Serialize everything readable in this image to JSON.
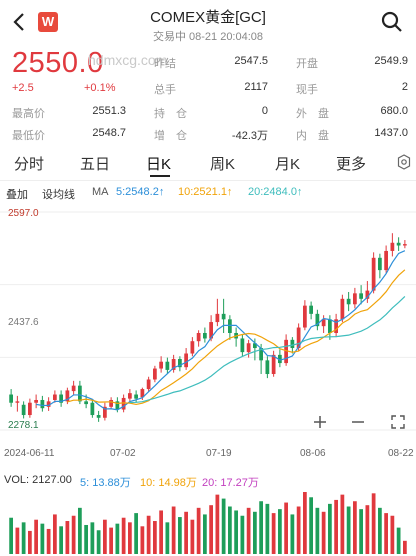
{
  "header": {
    "title": "COMEX黄金[GC]",
    "subtitle": "交易中 08-21 20:04:08",
    "logo_letter": "W",
    "back_icon": "back-arrow-icon",
    "search_icon": "search-icon"
  },
  "quote": {
    "price": "2550.0",
    "change": "+2.5",
    "change_pct": "+0.1%",
    "watermark": "hdmxcg.com",
    "stats": {
      "r1": [
        {
          "label": "昨结",
          "value": "2547.5"
        },
        {
          "label": "开盘",
          "value": "2549.9"
        }
      ],
      "r2": [
        {
          "label": "总手",
          "value": "2117"
        },
        {
          "label": "现手",
          "value": "2"
        }
      ],
      "r3": [
        {
          "label": "最高价",
          "value": "2551.3"
        },
        {
          "label": "持　仓",
          "value": "0"
        },
        {
          "label": "外　盘",
          "value": "680.0"
        }
      ],
      "r4": [
        {
          "label": "最低价",
          "value": "2548.7"
        },
        {
          "label": "增　仓",
          "value": "-42.3万"
        },
        {
          "label": "内　盘",
          "value": "1437.0"
        }
      ]
    }
  },
  "tabs": [
    "分时",
    "五日",
    "日K",
    "周K",
    "月K",
    "更多"
  ],
  "active_tab": "日K",
  "settings_icon": "gear-icon",
  "ma_bar": {
    "overlay": "叠加",
    "set_line": "设均线",
    "ma_label": "MA",
    "ma5": "5:2548.2↑",
    "ma10": "10:2521.1↑",
    "ma20": "20:2484.0↑",
    "colors": {
      "ma5": "#2d8fd9",
      "ma10": "#f0a30a",
      "ma20": "#3fbdbd"
    }
  },
  "chart_data": {
    "type": "candlestick",
    "y_max_label": "2597.0",
    "y_mid_label": "2437.6",
    "y_min_label": "2278.1",
    "ylim": [
      2278.1,
      2597.0
    ],
    "x_labels": [
      "2024-06-11",
      "07-02",
      "07-19",
      "08-06",
      "08-22"
    ],
    "candles": [
      [
        2330,
        2318,
        2338,
        2312
      ],
      [
        2318,
        2320,
        2328,
        2305
      ],
      [
        2315,
        2300,
        2320,
        2295
      ],
      [
        2300,
        2318,
        2324,
        2296
      ],
      [
        2318,
        2322,
        2330,
        2310
      ],
      [
        2322,
        2310,
        2328,
        2305
      ],
      [
        2312,
        2320,
        2326,
        2306
      ],
      [
        2322,
        2330,
        2336,
        2318
      ],
      [
        2330,
        2318,
        2336,
        2312
      ],
      [
        2320,
        2336,
        2340,
        2316
      ],
      [
        2335,
        2343,
        2350,
        2330
      ],
      [
        2343,
        2320,
        2350,
        2316
      ],
      [
        2320,
        2316,
        2330,
        2310
      ],
      [
        2318,
        2300,
        2322,
        2296
      ],
      [
        2300,
        2296,
        2306,
        2290
      ],
      [
        2296,
        2312,
        2318,
        2292
      ],
      [
        2312,
        2322,
        2326,
        2308
      ],
      [
        2320,
        2308,
        2326,
        2304
      ],
      [
        2308,
        2325,
        2330,
        2304
      ],
      [
        2324,
        2332,
        2338,
        2320
      ],
      [
        2330,
        2324,
        2336,
        2318
      ],
      [
        2326,
        2338,
        2340,
        2322
      ],
      [
        2338,
        2352,
        2356,
        2334
      ],
      [
        2352,
        2368,
        2372,
        2348
      ],
      [
        2368,
        2378,
        2386,
        2362
      ],
      [
        2378,
        2366,
        2384,
        2360
      ],
      [
        2366,
        2382,
        2388,
        2362
      ],
      [
        2382,
        2370,
        2386,
        2364
      ],
      [
        2370,
        2390,
        2398,
        2366
      ],
      [
        2390,
        2408,
        2414,
        2386
      ],
      [
        2408,
        2420,
        2424,
        2400
      ],
      [
        2420,
        2412,
        2428,
        2406
      ],
      [
        2412,
        2436,
        2446,
        2408
      ],
      [
        2436,
        2448,
        2470,
        2430
      ],
      [
        2448,
        2440,
        2470,
        2420
      ],
      [
        2440,
        2420,
        2446,
        2410
      ],
      [
        2420,
        2412,
        2428,
        2400
      ],
      [
        2412,
        2392,
        2418,
        2386
      ],
      [
        2392,
        2405,
        2410,
        2384
      ],
      [
        2405,
        2398,
        2412,
        2380
      ],
      [
        2398,
        2380,
        2404,
        2360
      ],
      [
        2380,
        2360,
        2386,
        2354
      ],
      [
        2360,
        2388,
        2394,
        2356
      ],
      [
        2388,
        2376,
        2396,
        2370
      ],
      [
        2376,
        2410,
        2418,
        2372
      ],
      [
        2410,
        2398,
        2414,
        2390
      ],
      [
        2398,
        2428,
        2434,
        2394
      ],
      [
        2428,
        2460,
        2468,
        2424
      ],
      [
        2460,
        2448,
        2466,
        2440
      ],
      [
        2448,
        2430,
        2454,
        2424
      ],
      [
        2430,
        2440,
        2446,
        2420
      ],
      [
        2440,
        2420,
        2446,
        2410
      ],
      [
        2420,
        2440,
        2448,
        2414
      ],
      [
        2440,
        2470,
        2476,
        2436
      ],
      [
        2470,
        2462,
        2480,
        2452
      ],
      [
        2462,
        2478,
        2486,
        2456
      ],
      [
        2478,
        2470,
        2490,
        2462
      ],
      [
        2470,
        2482,
        2496,
        2464
      ],
      [
        2482,
        2530,
        2538,
        2478
      ],
      [
        2530,
        2512,
        2536,
        2500
      ],
      [
        2512,
        2540,
        2548,
        2508
      ],
      [
        2540,
        2552,
        2566,
        2532
      ],
      [
        2552,
        2548,
        2560,
        2540
      ],
      [
        2548,
        2550,
        2556,
        2544
      ]
    ],
    "volume": [
      55,
      40,
      48,
      35,
      52,
      46,
      38,
      60,
      42,
      50,
      58,
      70,
      44,
      48,
      36,
      52,
      40,
      46,
      55,
      48,
      62,
      42,
      58,
      50,
      66,
      48,
      72,
      56,
      64,
      52,
      70,
      60,
      74,
      90,
      84,
      72,
      66,
      58,
      70,
      64,
      80,
      76,
      62,
      68,
      78,
      60,
      72,
      94,
      86,
      70,
      64,
      76,
      82,
      90,
      72,
      80,
      68,
      74,
      92,
      70,
      62,
      58,
      40,
      20
    ],
    "vol_label": "VOL: 2127.00",
    "vol_ma5": "5: 13.88万",
    "vol_ma10": "10: 14.98万",
    "vol_ma20": "20: 17.27万"
  },
  "colors": {
    "up": "#e0393e",
    "down": "#1e9e5a",
    "grid": "#eeeeee"
  }
}
